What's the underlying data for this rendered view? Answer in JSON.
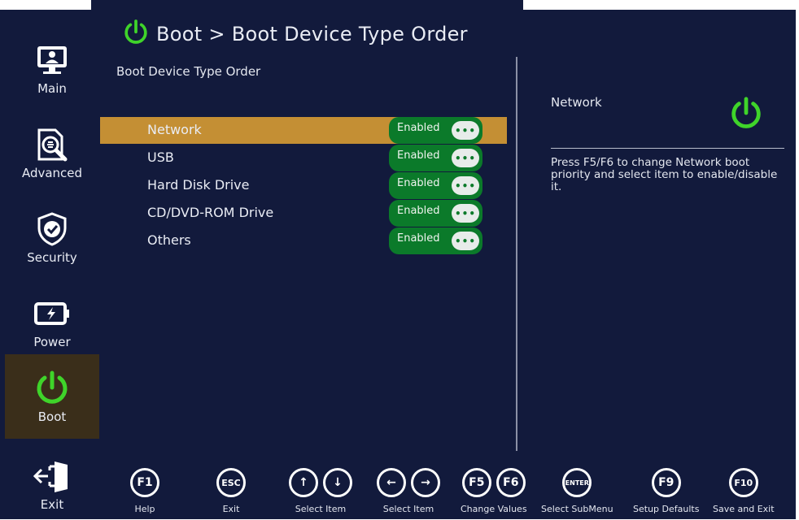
{
  "header": {
    "breadcrumb": "Boot > Boot Device Type Order",
    "subtitle": "Boot Device Type Order"
  },
  "sidebar": {
    "items": [
      {
        "label": "Main",
        "icon": "monitor-icon"
      },
      {
        "label": "Advanced",
        "icon": "advanced-icon"
      },
      {
        "label": "Security",
        "icon": "shield-icon"
      },
      {
        "label": "Power",
        "icon": "battery-icon"
      },
      {
        "label": "Boot",
        "icon": "power-icon"
      },
      {
        "label": "Exit",
        "icon": "exit-icon"
      }
    ],
    "active": "Boot"
  },
  "boot_order": {
    "items": [
      {
        "name": "Network",
        "state": "Enabled",
        "knob": "•••"
      },
      {
        "name": "USB",
        "state": "Enabled",
        "knob": "•••"
      },
      {
        "name": "Hard Disk Drive",
        "state": "Enabled",
        "knob": "•••"
      },
      {
        "name": "CD/DVD-ROM Drive",
        "state": "Enabled",
        "knob": "•••"
      },
      {
        "name": "Others",
        "state": "Enabled",
        "knob": "•••"
      }
    ],
    "selected": "Network"
  },
  "help": {
    "title": "Network",
    "text": "Press F5/F6 to change Network boot priority and select item to enable/disable it."
  },
  "footer": {
    "keys": [
      {
        "keys": [
          "F1"
        ],
        "label": "Help"
      },
      {
        "keys": [
          "ESC"
        ],
        "label": "Exit"
      },
      {
        "keys": [
          "↑",
          "↓"
        ],
        "label": "Select Item"
      },
      {
        "keys": [
          "←",
          "→"
        ],
        "label": "Select Item"
      },
      {
        "keys": [
          "F5",
          "F6"
        ],
        "label": "Change Values"
      },
      {
        "keys": [
          "ENTER"
        ],
        "label": "Select SubMenu"
      },
      {
        "keys": [
          "F9"
        ],
        "label": "Setup Defaults"
      },
      {
        "keys": [
          "F10"
        ],
        "label": "Save and Exit"
      }
    ]
  },
  "colors": {
    "background": "#121a3c",
    "selected_row": "#c48f34",
    "toggle_green": "#0b7a2a",
    "power_green": "#3fd42a",
    "active_sidebar": "#3a2e1a"
  }
}
